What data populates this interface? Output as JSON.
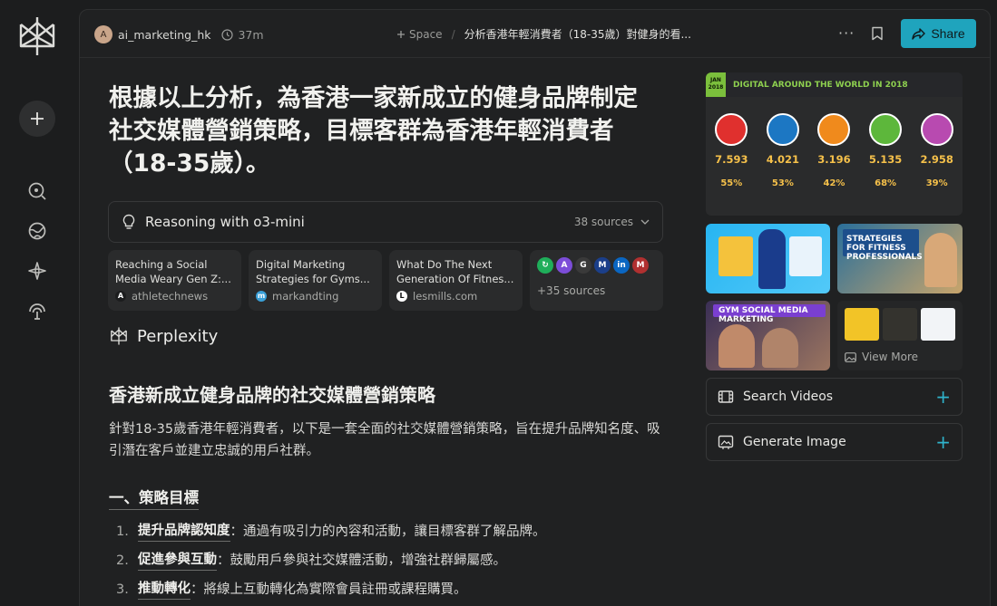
{
  "rail": {
    "items": [
      "logo-icon",
      "new-thread-icon",
      "discover-icon",
      "spaces-icon",
      "library-icon",
      "broadcast-icon"
    ]
  },
  "topbar": {
    "avatar_letter": "A",
    "author": "ai_marketing_hk",
    "time": "37m",
    "space_label": "Space",
    "breadcrumb_sep": "/",
    "thread_title": "分析香港年輕消費者（18-35歲）對健身的看...",
    "more_label": "···",
    "share_label": "Share"
  },
  "main": {
    "title": "根據以上分析，為香港一家新成立的健身品牌制定社交媒體營銷策略，目標客群為香港年輕消費者（18-35歲）。",
    "reasoning_label": "Reasoning with o3-mini",
    "sources_count": "38 sources",
    "sources": [
      {
        "title": "Reaching a Social Media Weary Gen Z:...",
        "host": "athletechnews",
        "fav": "A",
        "fav_color": "#ffffff",
        "fav_bg": "#1c1d1e"
      },
      {
        "title": "Digital Marketing Strategies for Gyms...",
        "host": "markandting",
        "fav": "m",
        "fav_color": "#ffffff",
        "fav_bg": "#3aa0d8"
      },
      {
        "title": "What Do The Next Generation Of Fitnes...",
        "host": "lesmills.com",
        "fav": "L",
        "fav_color": "#111111",
        "fav_bg": "#ffffff"
      }
    ],
    "more_sources": "+35 sources",
    "more_favicons": [
      {
        "letter": "↻",
        "bg": "#1fae5a"
      },
      {
        "letter": "A",
        "bg": "#7c4dd8"
      },
      {
        "letter": "G",
        "bg": "#3a3a3a"
      },
      {
        "letter": "M",
        "bg": "#1b3f8a"
      },
      {
        "letter": "in",
        "bg": "#0a66c2"
      },
      {
        "letter": "M",
        "bg": "#b03030"
      }
    ],
    "brand": "Perplexity",
    "h2": "香港新成立健身品牌的社交媒體營銷策略",
    "intro": "針對18-35歲香港年輕消費者，以下是一套全面的社交媒體營銷策略，旨在提升品牌知名度、吸引潛在客戶並建立忠誠的用戶社群。",
    "h3": "一、策略目標",
    "goals": [
      {
        "num": "1.",
        "bold": "提升品牌認知度",
        "text": "：通過有吸引力的內容和活動，讓目標客群了解品牌。"
      },
      {
        "num": "2.",
        "bold": "促進參與互動",
        "text": "：鼓勵用戶參與社交媒體活動，增強社群歸屬感。"
      },
      {
        "num": "3.",
        "bold": "推動轉化",
        "text": "：將線上互動轉化為實際會員註冊或課程購買。"
      }
    ]
  },
  "right": {
    "hero": {
      "badge": "JAN 2018",
      "title": "DIGITAL AROUND THE WORLD IN 2018",
      "stats": [
        {
          "value": "7.593",
          "sub": "55%",
          "color": "#e0302e"
        },
        {
          "value": "4.021",
          "sub": "53%",
          "color": "#1c77c3"
        },
        {
          "value": "3.196",
          "sub": "42%",
          "color": "#f08a1c"
        },
        {
          "value": "5.135",
          "sub": "68%",
          "color": "#5db73b"
        },
        {
          "value": "2.958",
          "sub": "39%",
          "color": "#b84ab0"
        }
      ]
    },
    "thumb2_caption": "STRATEGIES FOR FITNESS PROFESSIONALS",
    "thumb3_caption": "GYM SOCIAL MEDIA MARKETING",
    "view_more": "View More",
    "search_videos": "Search Videos",
    "generate_image": "Generate Image",
    "plus": "+"
  }
}
